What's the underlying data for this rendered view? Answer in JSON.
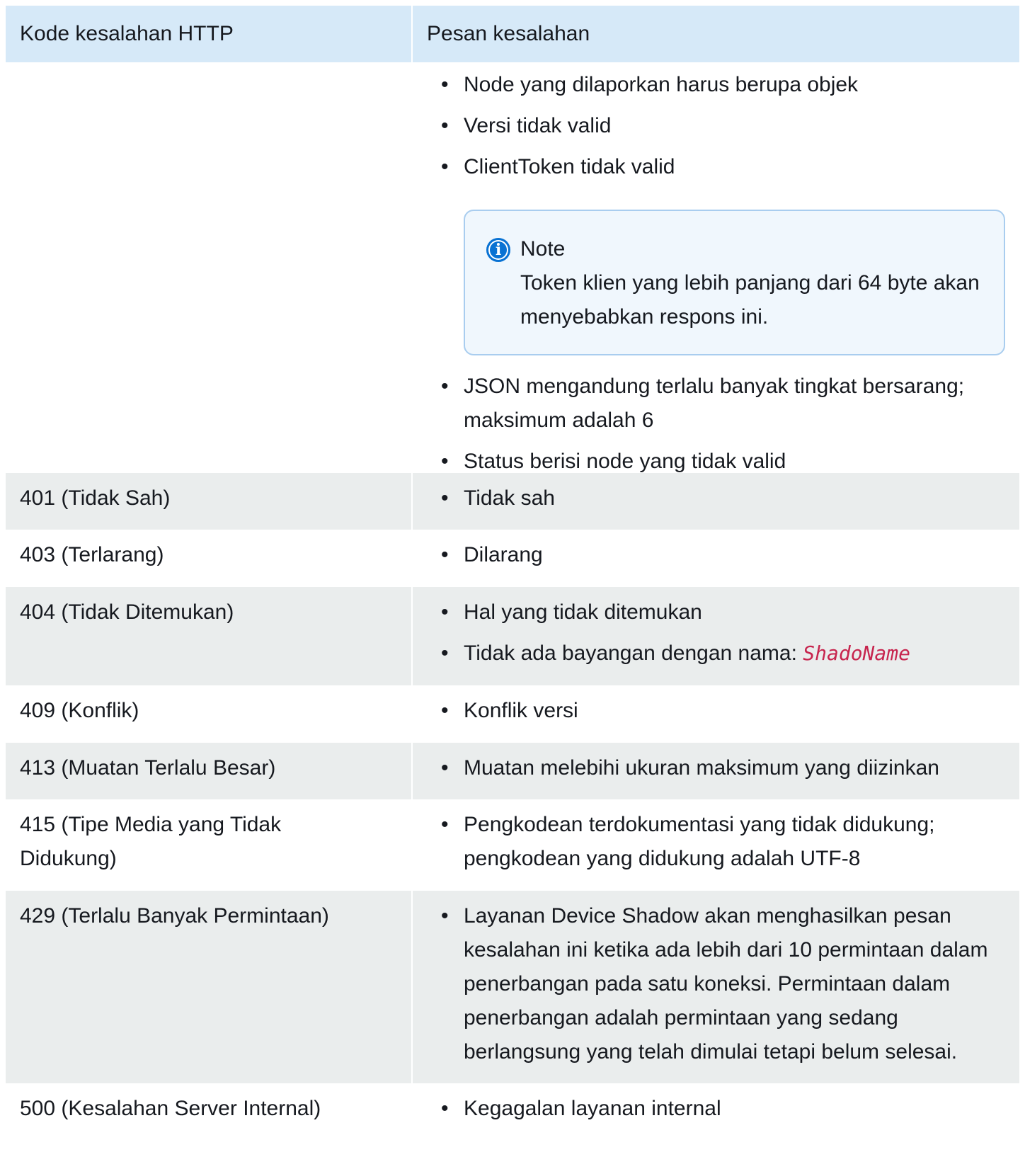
{
  "header": {
    "code_col": "Kode kesalahan HTTP",
    "msg_col": "Pesan kesalahan"
  },
  "row_400": {
    "messages_before": [
      "Node yang dilaporkan harus berupa objek",
      "Versi tidak valid",
      "ClientToken tidak valid"
    ],
    "note": {
      "title": "Note",
      "icon": "info-icon",
      "text": "Token klien yang lebih panjang dari 64 byte akan menyebabkan respons ini."
    },
    "messages_after": [
      "JSON mengandung terlalu banyak tingkat bersarang; maksimum adalah 6",
      "Status berisi node yang tidak valid"
    ]
  },
  "rows": [
    {
      "code": "401 (Tidak Sah)",
      "messages": [
        "Tidak sah"
      ]
    },
    {
      "code": "403 (Terlarang)",
      "messages": [
        "Dilarang"
      ]
    },
    {
      "code": "404 (Tidak Ditemukan)",
      "messages": [
        "Hal yang tidak ditemukan"
      ],
      "shadow_prefix": "Tidak ada bayangan dengan nama: ",
      "shadow_var": "ShadoName"
    },
    {
      "code": "409 (Konflik)",
      "messages": [
        "Konflik versi"
      ]
    },
    {
      "code": "413 (Muatan Terlalu Besar)",
      "messages": [
        "Muatan melebihi ukuran maksimum yang diizinkan"
      ]
    },
    {
      "code": "415 (Tipe Media yang Tidak Didukung)",
      "messages": [
        "Pengkodean terdokumentasi yang tidak didukung; pengkodean yang didukung adalah UTF-8"
      ]
    },
    {
      "code": "429 (Terlalu Banyak Permintaan)",
      "messages": [
        "Layanan Device Shadow akan menghasilkan pesan kesalahan ini ketika ada lebih dari 10 permintaan dalam penerbangan pada satu koneksi. Permintaan dalam penerbangan adalah permintaan yang sedang berlangsung yang telah dimulai tetapi belum selesai."
      ]
    },
    {
      "code": "500 (Kesalahan Server Internal)",
      "messages": [
        "Kegagalan layanan internal"
      ]
    }
  ],
  "colors": {
    "header_bg": "#d6e9f8",
    "row_grey": "#eaeded",
    "note_border": "#a9cdef",
    "note_bg": "#f0f7fd",
    "info_icon": "#0972d3",
    "code_var": "#c7254e"
  }
}
